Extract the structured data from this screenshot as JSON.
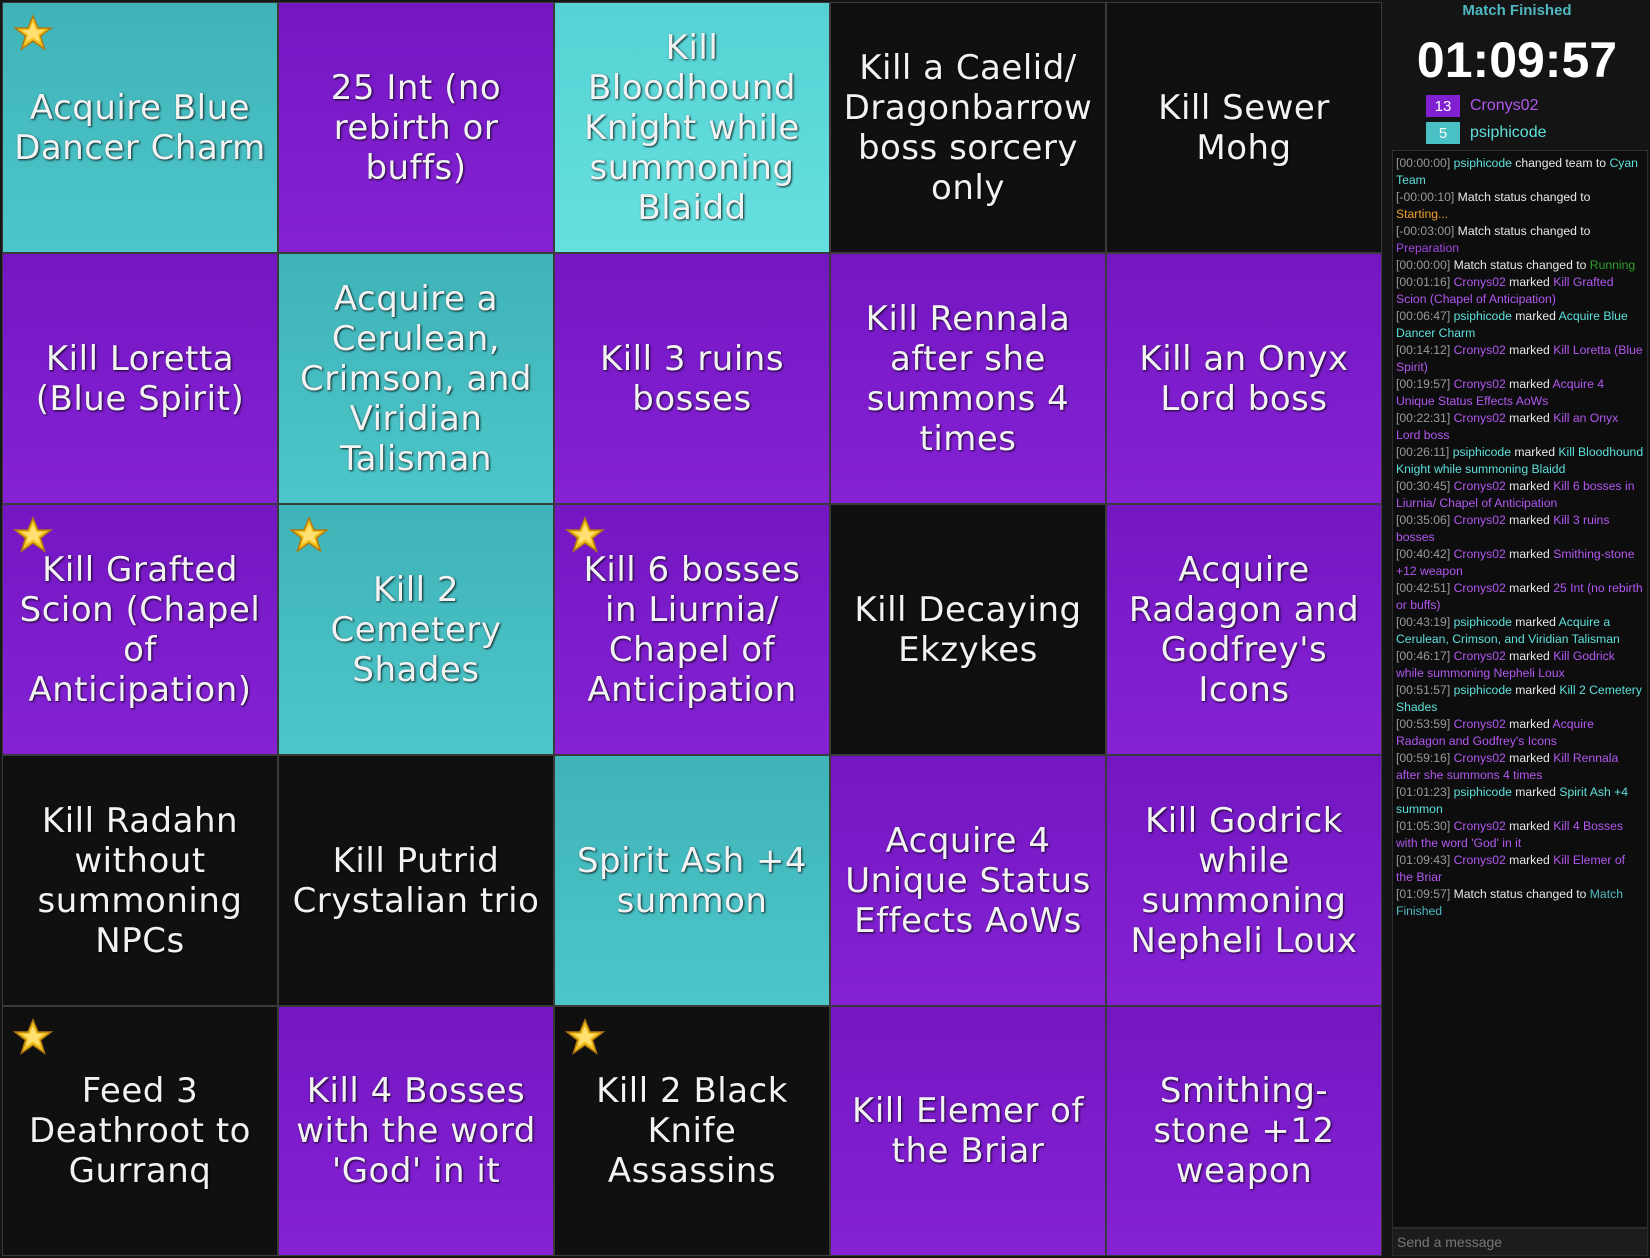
{
  "colors": {
    "purple": "#8020d0",
    "cyan": "#48c0c4",
    "cyan_light": "#62dedd",
    "black": "#101010",
    "status": "#4fb8c0"
  },
  "board": {
    "cells": [
      {
        "text": "Acquire Blue Dancer Charm",
        "color": "cyan",
        "star": true
      },
      {
        "text": "25 Int (no rebirth or buffs)",
        "color": "purple",
        "star": false
      },
      {
        "text": "Kill Bloodhound Knight while summoning Blaidd",
        "color": "cyanlight",
        "star": false
      },
      {
        "text": "Kill a Caelid/ Dragonbarrow boss sorcery only",
        "color": "black",
        "star": false
      },
      {
        "text": "Kill Sewer Mohg",
        "color": "black",
        "star": false
      },
      {
        "text": "Kill Loretta (Blue Spirit)",
        "color": "purple",
        "star": false
      },
      {
        "text": "Acquire a Cerulean, Crimson, and Viridian Talisman",
        "color": "cyan",
        "star": false
      },
      {
        "text": "Kill 3 ruins bosses",
        "color": "purple",
        "star": false
      },
      {
        "text": "Kill Rennala after she summons 4 times",
        "color": "purple",
        "star": false
      },
      {
        "text": "Kill an Onyx Lord boss",
        "color": "purple",
        "star": false
      },
      {
        "text": "Kill Grafted Scion (Chapel of Anticipation)",
        "color": "purple",
        "star": true
      },
      {
        "text": "Kill 2 Cemetery Shades",
        "color": "cyan",
        "star": true
      },
      {
        "text": "Kill 6 bosses in Liurnia/ Chapel of Anticipation",
        "color": "purple",
        "star": true
      },
      {
        "text": "Kill Decaying Ekzykes",
        "color": "black",
        "star": false
      },
      {
        "text": "Acquire Radagon and Godfrey's Icons",
        "color": "purple",
        "star": false
      },
      {
        "text": "Kill Radahn without summoning NPCs",
        "color": "black",
        "star": false
      },
      {
        "text": "Kill Putrid Crystalian trio",
        "color": "black",
        "star": false
      },
      {
        "text": "Spirit Ash +4 summon",
        "color": "cyan",
        "star": false
      },
      {
        "text": "Acquire 4 Unique Status Effects AoWs",
        "color": "purple",
        "star": false
      },
      {
        "text": "Kill Godrick while summoning Nepheli Loux",
        "color": "purple",
        "star": false
      },
      {
        "text": "Feed 3 Deathroot to Gurranq",
        "color": "black",
        "star": true
      },
      {
        "text": "Kill 4 Bosses with the word 'God' in it",
        "color": "purple",
        "star": false
      },
      {
        "text": "Kill 2 Black Knife Assassins",
        "color": "black",
        "star": true
      },
      {
        "text": "Kill Elemer of the Briar",
        "color": "purple",
        "star": false
      },
      {
        "text": "Smithing-stone +12 weapon",
        "color": "purple",
        "star": false
      }
    ]
  },
  "sidebar": {
    "status": "Match Finished",
    "timer": "01:09:57",
    "teams": [
      {
        "score": "13",
        "name": "Cronys02",
        "color": "#8020d0",
        "text_color": "#b258f0"
      },
      {
        "score": "5",
        "name": "psiphicode",
        "color": "#48c0c4",
        "text_color": "#5ee0dc"
      }
    ],
    "log": [
      {
        "ts": "[00:00:00]",
        "parts": [
          {
            "t": " "
          },
          {
            "t": "psiphicode",
            "c": "pl-cyan"
          },
          {
            "t": " changed team to "
          },
          {
            "t": "Cyan Team",
            "c": "goal-cyan"
          }
        ]
      },
      {
        "ts": "[-00:00:10]",
        "parts": [
          {
            "t": " Match status changed to "
          },
          {
            "t": "Starting...",
            "c": "st-orange"
          }
        ]
      },
      {
        "ts": "[-00:03:00]",
        "parts": [
          {
            "t": " Match status changed to "
          },
          {
            "t": "Preparation",
            "c": "st-purple"
          }
        ]
      },
      {
        "ts": "[00:00:00]",
        "parts": [
          {
            "t": " Match status changed to "
          },
          {
            "t": "Running",
            "c": "st-green"
          }
        ]
      },
      {
        "ts": "[00:01:16]",
        "parts": [
          {
            "t": " "
          },
          {
            "t": "Cronys02",
            "c": "pl-purple"
          },
          {
            "t": " marked "
          },
          {
            "t": "Kill Grafted Scion (Chapel of Anticipation)",
            "c": "goal-purple"
          }
        ]
      },
      {
        "ts": "[00:06:47]",
        "parts": [
          {
            "t": " "
          },
          {
            "t": "psiphicode",
            "c": "pl-cyan"
          },
          {
            "t": " marked "
          },
          {
            "t": "Acquire Blue Dancer Charm",
            "c": "goal-cyan"
          }
        ]
      },
      {
        "ts": "[00:14:12]",
        "parts": [
          {
            "t": " "
          },
          {
            "t": "Cronys02",
            "c": "pl-purple"
          },
          {
            "t": " marked "
          },
          {
            "t": "Kill Loretta (Blue Spirit)",
            "c": "goal-purple"
          }
        ]
      },
      {
        "ts": "[00:19:57]",
        "parts": [
          {
            "t": " "
          },
          {
            "t": "Cronys02",
            "c": "pl-purple"
          },
          {
            "t": " marked "
          },
          {
            "t": "Acquire 4 Unique Status Effects AoWs",
            "c": "goal-purple"
          }
        ]
      },
      {
        "ts": "[00:22:31]",
        "parts": [
          {
            "t": " "
          },
          {
            "t": "Cronys02",
            "c": "pl-purple"
          },
          {
            "t": " marked "
          },
          {
            "t": "Kill an Onyx Lord boss",
            "c": "goal-purple"
          }
        ]
      },
      {
        "ts": "[00:26:11]",
        "parts": [
          {
            "t": " "
          },
          {
            "t": "psiphicode",
            "c": "pl-cyan"
          },
          {
            "t": " marked "
          },
          {
            "t": "Kill Bloodhound Knight while summoning Blaidd",
            "c": "goal-cyan"
          }
        ]
      },
      {
        "ts": "[00:30:45]",
        "parts": [
          {
            "t": " "
          },
          {
            "t": "Cronys02",
            "c": "pl-purple"
          },
          {
            "t": " marked "
          },
          {
            "t": "Kill 6 bosses in Liurnia/ Chapel of Anticipation",
            "c": "goal-purple"
          }
        ]
      },
      {
        "ts": "[00:35:06]",
        "parts": [
          {
            "t": " "
          },
          {
            "t": "Cronys02",
            "c": "pl-purple"
          },
          {
            "t": " marked "
          },
          {
            "t": "Kill 3 ruins bosses",
            "c": "goal-purple"
          }
        ]
      },
      {
        "ts": "[00:40:42]",
        "parts": [
          {
            "t": " "
          },
          {
            "t": "Cronys02",
            "c": "pl-purple"
          },
          {
            "t": " marked "
          },
          {
            "t": "Smithing-stone +12 weapon",
            "c": "goal-purple"
          }
        ]
      },
      {
        "ts": "[00:42:51]",
        "parts": [
          {
            "t": " "
          },
          {
            "t": "Cronys02",
            "c": "pl-purple"
          },
          {
            "t": " marked "
          },
          {
            "t": "25 Int (no rebirth or buffs)",
            "c": "goal-purple"
          }
        ]
      },
      {
        "ts": "[00:43:19]",
        "parts": [
          {
            "t": " "
          },
          {
            "t": "psiphicode",
            "c": "pl-cyan"
          },
          {
            "t": " marked "
          },
          {
            "t": "Acquire a Cerulean, Crimson, and Viridian Talisman",
            "c": "goal-cyan"
          }
        ]
      },
      {
        "ts": "[00:46:17]",
        "parts": [
          {
            "t": " "
          },
          {
            "t": "Cronys02",
            "c": "pl-purple"
          },
          {
            "t": " marked "
          },
          {
            "t": "Kill Godrick while summoning Nepheli Loux",
            "c": "goal-purple"
          }
        ]
      },
      {
        "ts": "[00:51:57]",
        "parts": [
          {
            "t": " "
          },
          {
            "t": "psiphicode",
            "c": "pl-cyan"
          },
          {
            "t": " marked "
          },
          {
            "t": "Kill 2 Cemetery Shades",
            "c": "goal-cyan"
          }
        ]
      },
      {
        "ts": "[00:53:59]",
        "parts": [
          {
            "t": " "
          },
          {
            "t": "Cronys02",
            "c": "pl-purple"
          },
          {
            "t": " marked "
          },
          {
            "t": "Acquire Radagon and Godfrey's Icons",
            "c": "goal-purple"
          }
        ]
      },
      {
        "ts": "[00:59:16]",
        "parts": [
          {
            "t": " "
          },
          {
            "t": "Cronys02",
            "c": "pl-purple"
          },
          {
            "t": " marked "
          },
          {
            "t": "Kill Rennala after she summons 4 times",
            "c": "goal-purple"
          }
        ]
      },
      {
        "ts": "[01:01:23]",
        "parts": [
          {
            "t": " "
          },
          {
            "t": "psiphicode",
            "c": "pl-cyan"
          },
          {
            "t": " marked "
          },
          {
            "t": "Spirit Ash +4 summon",
            "c": "goal-cyan"
          }
        ]
      },
      {
        "ts": "[01:05:30]",
        "parts": [
          {
            "t": " "
          },
          {
            "t": "Cronys02",
            "c": "pl-purple"
          },
          {
            "t": " marked "
          },
          {
            "t": "Kill 4 Bosses with the word 'God' in it",
            "c": "goal-purple"
          }
        ]
      },
      {
        "ts": "[01:09:43]",
        "parts": [
          {
            "t": " "
          },
          {
            "t": "Cronys02",
            "c": "pl-purple"
          },
          {
            "t": " marked "
          },
          {
            "t": "Kill Elemer of the Briar",
            "c": "goal-purple"
          }
        ]
      },
      {
        "ts": "[01:09:57]",
        "parts": [
          {
            "t": " Match status changed to "
          },
          {
            "t": "Match Finished",
            "c": "st-blue"
          }
        ]
      }
    ],
    "message_placeholder": "Send a message"
  }
}
